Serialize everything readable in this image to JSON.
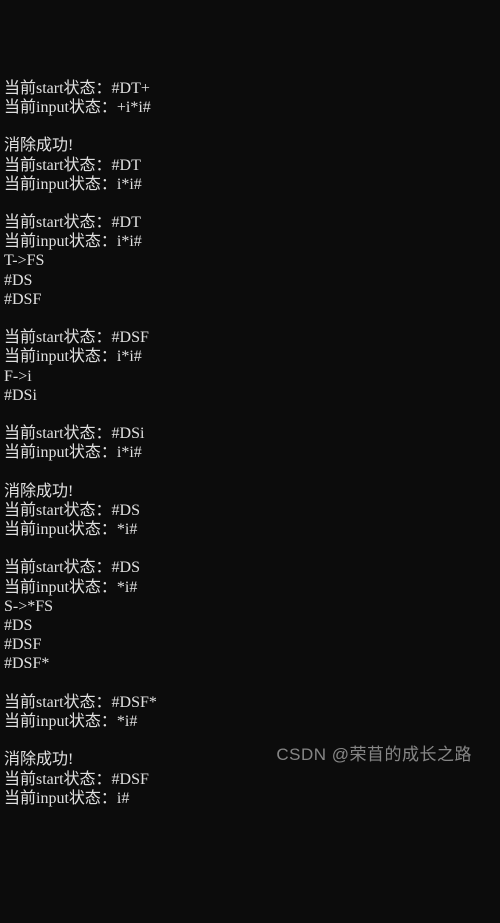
{
  "terminal": {
    "lines": [
      "当前start状态：#DT+",
      "当前input状态：+i*i#",
      "",
      "消除成功!",
      "当前start状态：#DT",
      "当前input状态：i*i#",
      "",
      "当前start状态：#DT",
      "当前input状态：i*i#",
      "T->FS",
      "#DS",
      "#DSF",
      "",
      "当前start状态：#DSF",
      "当前input状态：i*i#",
      "F->i",
      "#DSi",
      "",
      "当前start状态：#DSi",
      "当前input状态：i*i#",
      "",
      "消除成功!",
      "当前start状态：#DS",
      "当前input状态：*i#",
      "",
      "当前start状态：#DS",
      "当前input状态：*i#",
      "S->*FS",
      "#DS",
      "#DSF",
      "#DSF*",
      "",
      "当前start状态：#DSF*",
      "当前input状态：*i#",
      "",
      "消除成功!",
      "当前start状态：#DSF",
      "当前input状态：i#"
    ]
  },
  "watermark": "CSDN @荣苜的成长之路"
}
